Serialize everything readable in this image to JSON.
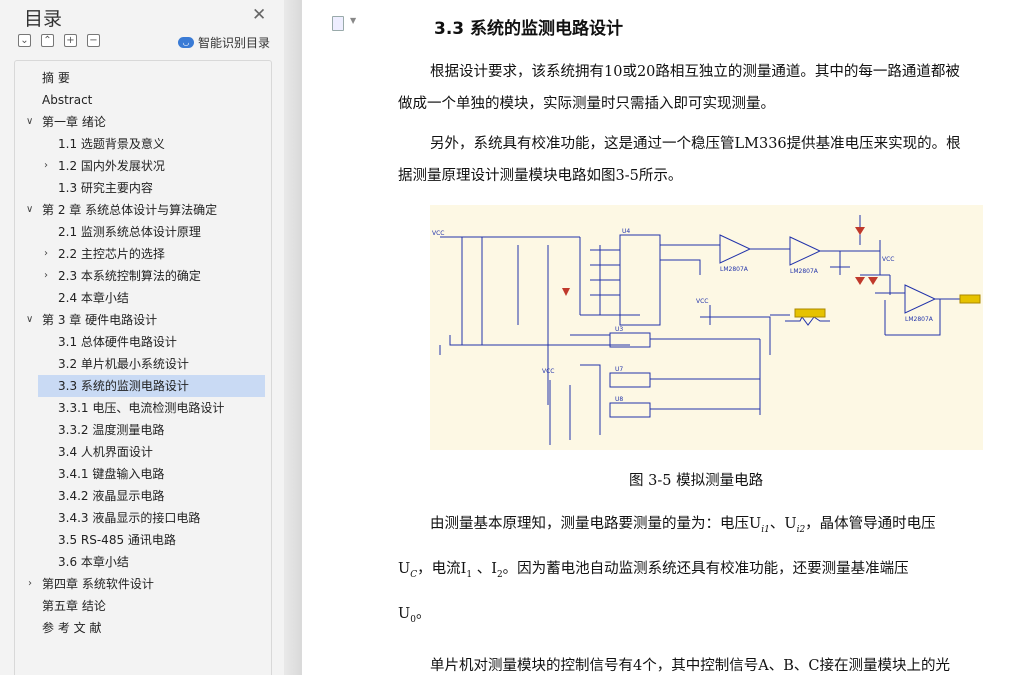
{
  "toc": {
    "title": "目录",
    "smart_label": "智能识别目录",
    "items": [
      {
        "label": "摘  要"
      },
      {
        "label": "Abstract"
      },
      {
        "label": "第一章   绪论"
      },
      {
        "label": "1.1  选题背景及意义"
      },
      {
        "label": "1.2  国内外发展状况"
      },
      {
        "label": "1.3  研究主要内容"
      },
      {
        "label": "第 2 章  系统总体设计与算法确定"
      },
      {
        "label": "2.1  监测系统总体设计原理"
      },
      {
        "label": "2.2  主控芯片的选择"
      },
      {
        "label": "2.3  本系统控制算法的确定"
      },
      {
        "label": "2.4  本章小结"
      },
      {
        "label": "第 3 章  硬件电路设计"
      },
      {
        "label": "3.1  总体硬件电路设计"
      },
      {
        "label": "3.2  单片机最小系统设计"
      },
      {
        "label": "3.3  系统的监测电路设计"
      },
      {
        "label": "3.3.1  电压、电流检测电路设计"
      },
      {
        "label": "3.3.2  温度测量电路"
      },
      {
        "label": "3.4  人机界面设计"
      },
      {
        "label": "3.4.1  键盘输入电路"
      },
      {
        "label": "3.4.2  液晶显示电路"
      },
      {
        "label": "3.4.3  液晶显示的接口电路"
      },
      {
        "label": "3.5 RS-485 通讯电路"
      },
      {
        "label": "3.6  本章小结"
      },
      {
        "label": "第四章  系统软件设计"
      },
      {
        "label": "第五章  结论"
      },
      {
        "label": "参 考 文 献"
      }
    ]
  },
  "doc": {
    "section_title": "3.3  系统的监测电路设计",
    "para1_line1": "根据设计要求，该系统拥有10或20路相互独立的测量通道。其中的每一路通道都被",
    "para1_line2": "做成一个单独的模块，实际测量时只需插入即可实现测量。",
    "para2_line1": "另外，系统具有校准功能，这是通过一个稳压管LM336提供基准电压来实现的。根",
    "para2_line2": "据测量原理设计测量模块电路如图3-5所示。",
    "figure_caption": "图 3-5 模拟测量电路",
    "para3_line1": "由测量基本原理知，测量电路要测量的量为：电压U",
    "para3_sub1": "i1",
    "para3_mid": "、U",
    "para3_sub2": "i2",
    "para3_end": "，晶体管导通时电压",
    "para4_a": "U",
    "para4_sub_c": "C",
    "para4_b": "，电流I",
    "para4_sub_1": "1",
    "para4_c": " 、I",
    "para4_sub_2": "2",
    "para4_d": "。因为蓄电池自动监测系统还具有校准功能，还要测量基准端压",
    "para5_a": "U",
    "para5_sub": "0",
    "para5_b": "。",
    "para6_line1": "单片机对测量模块的控制信号有4个，其中控制信号A、B、C接在测量模块上的光"
  },
  "colors": {
    "toc_bg": "#f3f3f3",
    "active_bg": "#c9daf4",
    "figure_bg": "#fdf8e4",
    "accent": "#3a7bd5"
  }
}
